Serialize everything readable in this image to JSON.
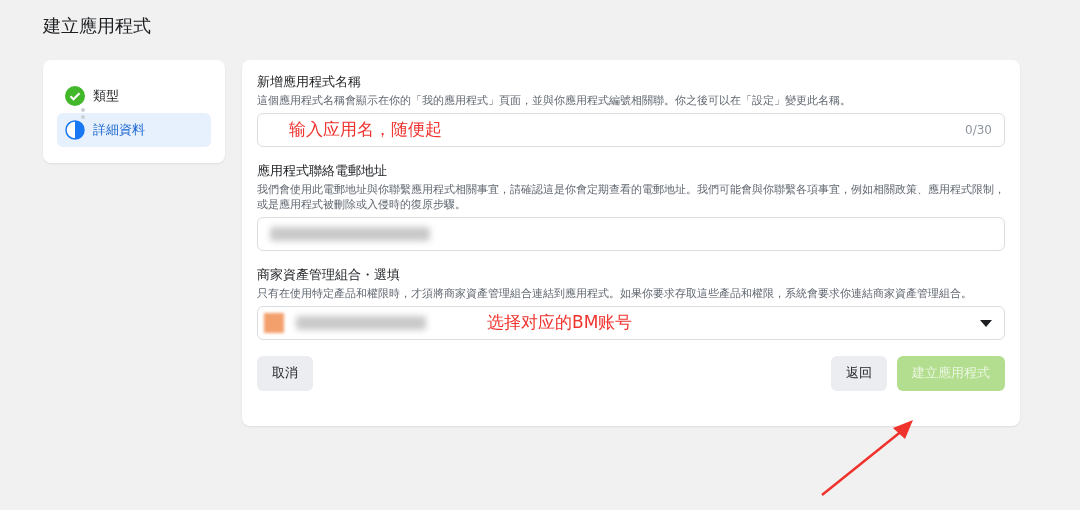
{
  "page_title": "建立應用程式",
  "steps": [
    {
      "label": "類型",
      "completed": true,
      "selected": false
    },
    {
      "label": "詳細資料",
      "completed": false,
      "selected": true
    }
  ],
  "fields": [
    {
      "kind": "text",
      "label": "新增應用程式名稱",
      "help": "這個應用程式名稱會顯示在你的「我的應用程式」頁面，並與你應用程式編號相關聯。你之後可以在「設定」變更此名稱。",
      "counter": "0/30",
      "annotation": "输入应用名，随便起"
    },
    {
      "kind": "email",
      "label": "應用程式聯絡電郵地址",
      "help": "我們會使用此電郵地址與你聯繫應用程式相關事宜，請確認這是你會定期查看的電郵地址。我們可能會與你聯繫各項事宜，例如相關政策、應用程式限制，或是應用程式被刪除或入侵時的復原步驟。"
    },
    {
      "kind": "select",
      "label": "商家資產管理組合・選填",
      "help": "只有在使用特定產品和權限時，才須將商家資產管理組合連結到應用程式。如果你要求存取這些產品和權限，系統會要求你連結商家資產管理組合。",
      "annotation": "选择对应的BM账号"
    }
  ],
  "buttons": [
    {
      "label": "取消",
      "kind": "secondary",
      "disabled": false
    },
    {
      "label": "返回",
      "kind": "secondary",
      "disabled": false
    },
    {
      "label": "建立應用程式",
      "kind": "primary",
      "disabled": true
    }
  ]
}
